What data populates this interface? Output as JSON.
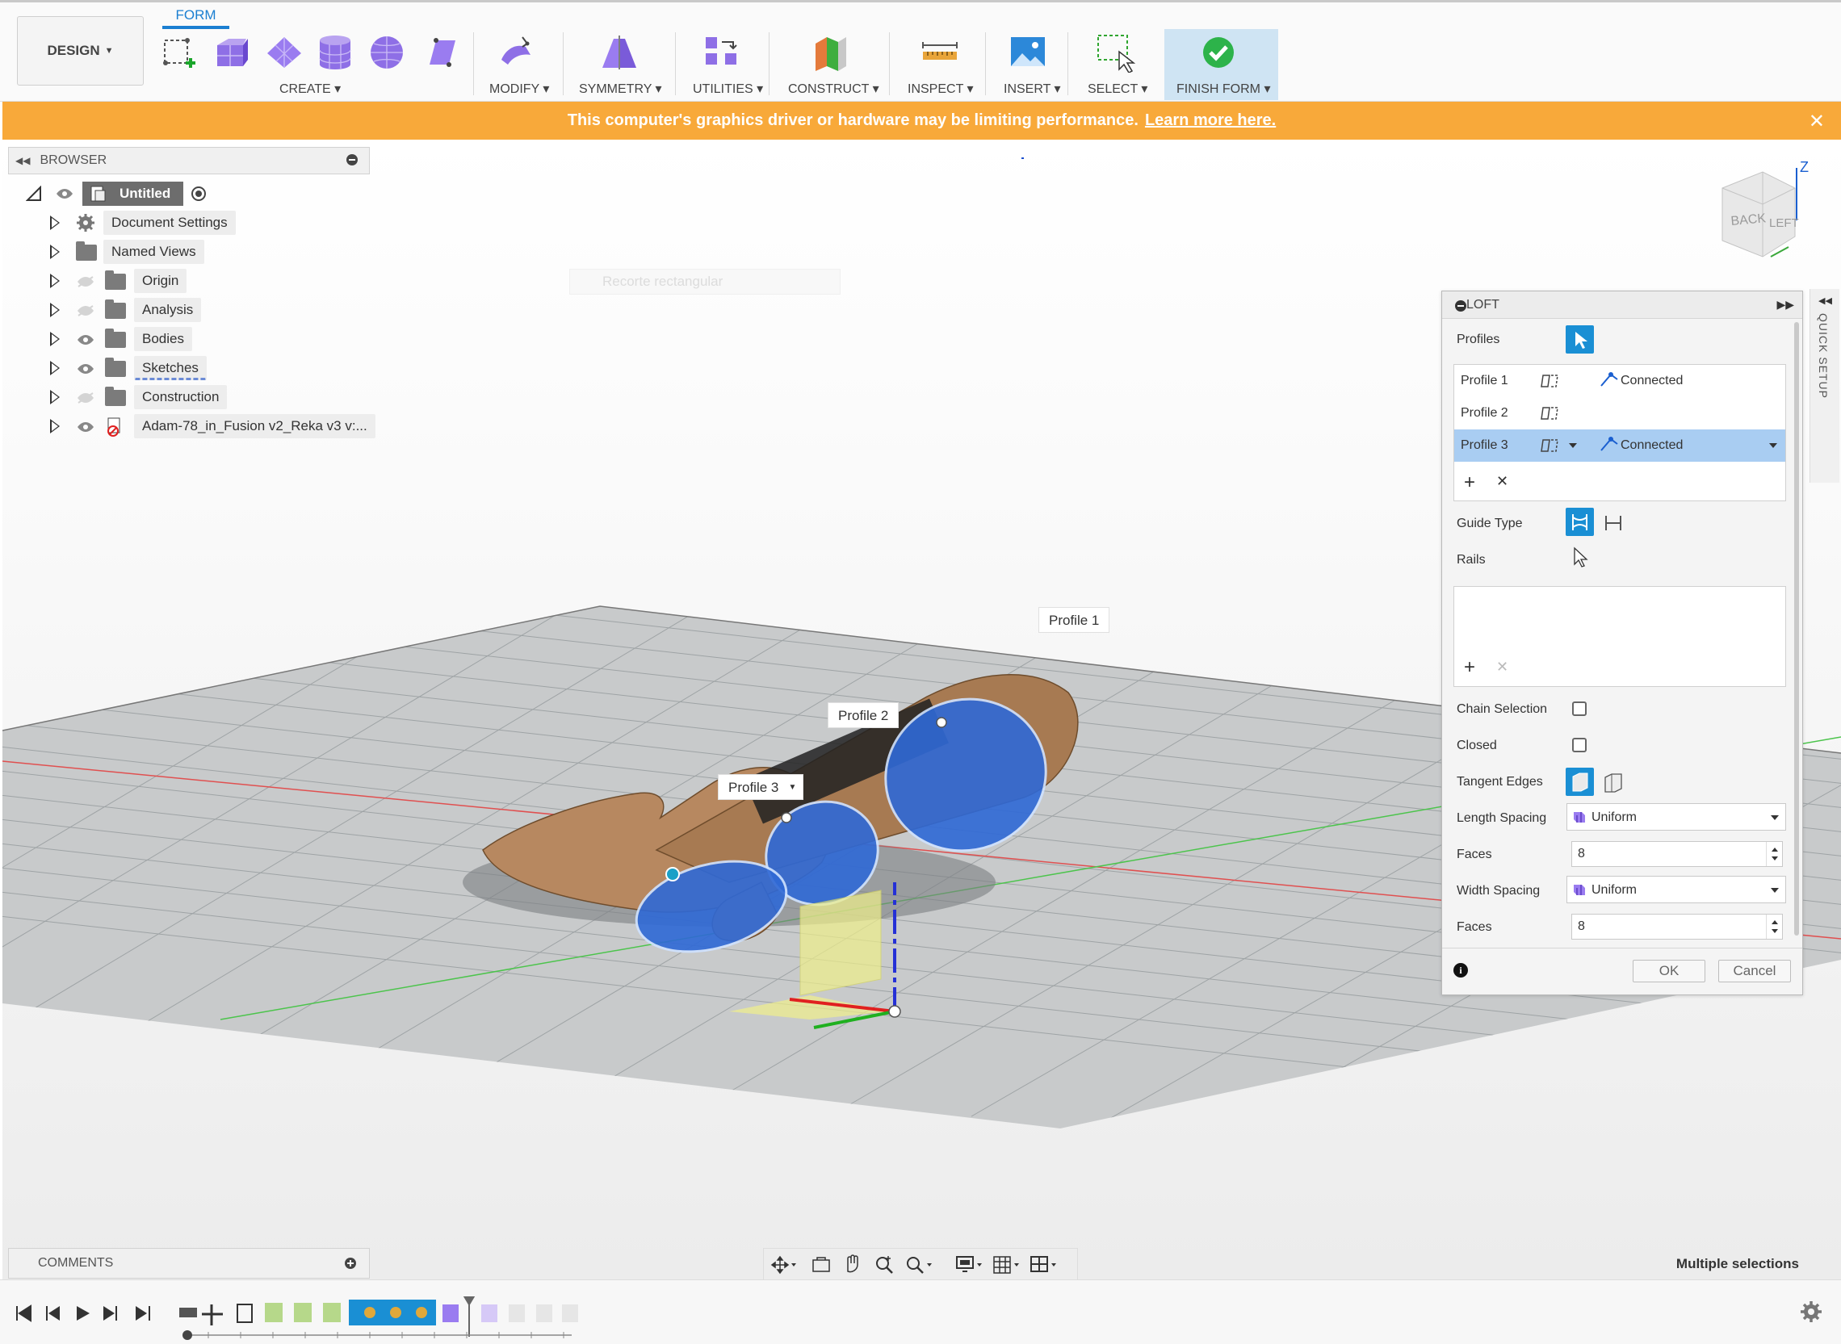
{
  "toolbar": {
    "workspace_label": "DESIGN",
    "active_tab": "FORM",
    "groups": [
      {
        "label": "CREATE"
      },
      {
        "label": "MODIFY"
      },
      {
        "label": "SYMMETRY"
      },
      {
        "label": "UTILITIES"
      },
      {
        "label": "CONSTRUCT"
      },
      {
        "label": "INSPECT"
      },
      {
        "label": "INSERT"
      },
      {
        "label": "SELECT"
      },
      {
        "label": "FINISH FORM"
      }
    ],
    "icons": [
      "create-box-icon",
      "box-icon",
      "plane-icon",
      "cylinder-icon",
      "sphere-icon",
      "quadball-icon",
      "modify-icon",
      "symmetry-icon",
      "utilities-icon",
      "construct-icon",
      "measure-icon",
      "insert-image-icon",
      "window-select-icon",
      "finish-form-checkmark-icon"
    ],
    "accent": "#1b7fd1"
  },
  "warning": {
    "message": "This computer's graphics driver or hardware may be limiting performance.",
    "link_text": "Learn more here.",
    "color": "#f8a93a"
  },
  "browser": {
    "title": "BROWSER",
    "root_label": "Untitled",
    "items": [
      {
        "label": "Document Settings",
        "icon": "gear-icon"
      },
      {
        "label": "Named Views",
        "icon": "folder-icon"
      },
      {
        "label": "Origin",
        "icon": "folder-icon"
      },
      {
        "label": "Analysis",
        "icon": "folder-icon"
      },
      {
        "label": "Bodies",
        "icon": "folder-icon"
      },
      {
        "label": "Sketches",
        "icon": "folder-icon"
      },
      {
        "label": "Construction",
        "icon": "folder-icon"
      },
      {
        "label": "Adam-78_in_Fusion v2_Reka v3 v:...",
        "icon": "component-link-icon"
      }
    ]
  },
  "viewport": {
    "ghost_text": "Recorte rectangular",
    "profile_labels": [
      "Profile 1",
      "Profile 2",
      "Profile 3"
    ],
    "viewcube": {
      "back": "BACK",
      "left": "LEFT",
      "axis": "Z"
    }
  },
  "loft": {
    "title": "LOFT",
    "profiles_label": "Profiles",
    "profiles": [
      {
        "name": "Profile 1",
        "continuity": "Connected"
      },
      {
        "name": "Profile 2",
        "continuity": ""
      },
      {
        "name": "Profile 3",
        "continuity": "Connected"
      }
    ],
    "guide_type_label": "Guide Type",
    "rails_label": "Rails",
    "chain_selection_label": "Chain Selection",
    "closed_label": "Closed",
    "tangent_edges_label": "Tangent Edges",
    "length_spacing_label": "Length Spacing",
    "length_spacing_value": "Uniform",
    "faces_label": "Faces",
    "faces_length_value": "8",
    "width_spacing_label": "Width Spacing",
    "width_spacing_value": "Uniform",
    "faces_width_value": "8",
    "ok_label": "OK",
    "cancel_label": "Cancel",
    "quick_setup_label": "QUICK SETUP"
  },
  "bottom": {
    "comments_label": "COMMENTS",
    "status_text": "Multiple selections"
  }
}
